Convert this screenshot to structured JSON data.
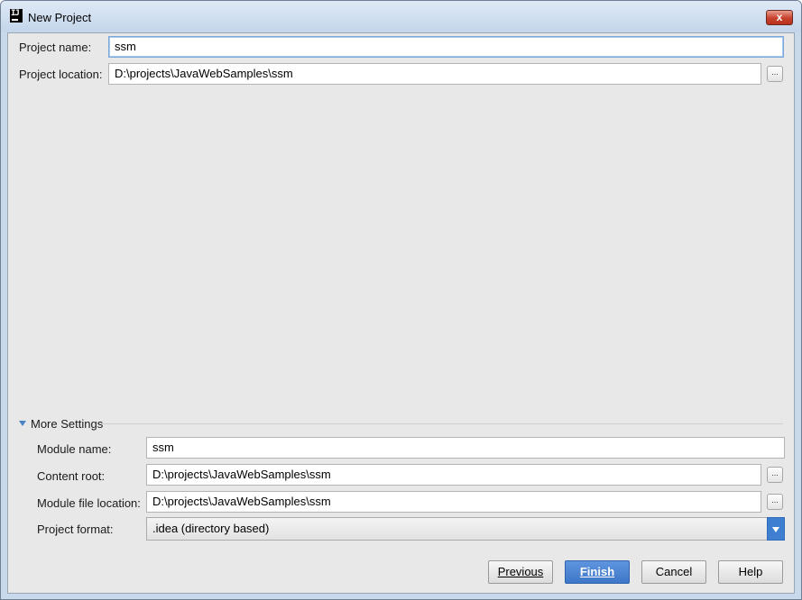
{
  "window": {
    "title": "New Project",
    "close_glyph": "x",
    "app_icon": "IJ"
  },
  "project": {
    "name_label": "Project name:",
    "name_value": "ssm",
    "location_label": "Project location:",
    "location_value": "D:\\projects\\JavaWebSamples\\ssm",
    "browse_glyph": "..."
  },
  "more_settings": {
    "toggle_label": "More Settings",
    "module_name_label": "Module name:",
    "module_name_value": "ssm",
    "content_root_label": "Content root:",
    "content_root_value": "D:\\projects\\JavaWebSamples\\ssm",
    "module_file_label": "Module file location:",
    "module_file_value": "D:\\projects\\JavaWebSamples\\ssm",
    "format_label": "Project format:",
    "format_value": ".idea (directory based)"
  },
  "buttons": {
    "previous": "Previous",
    "finish": "Finish",
    "cancel": "Cancel",
    "help": "Help"
  },
  "colors": {
    "accent": "#3e77c9",
    "close": "#c7412c"
  }
}
